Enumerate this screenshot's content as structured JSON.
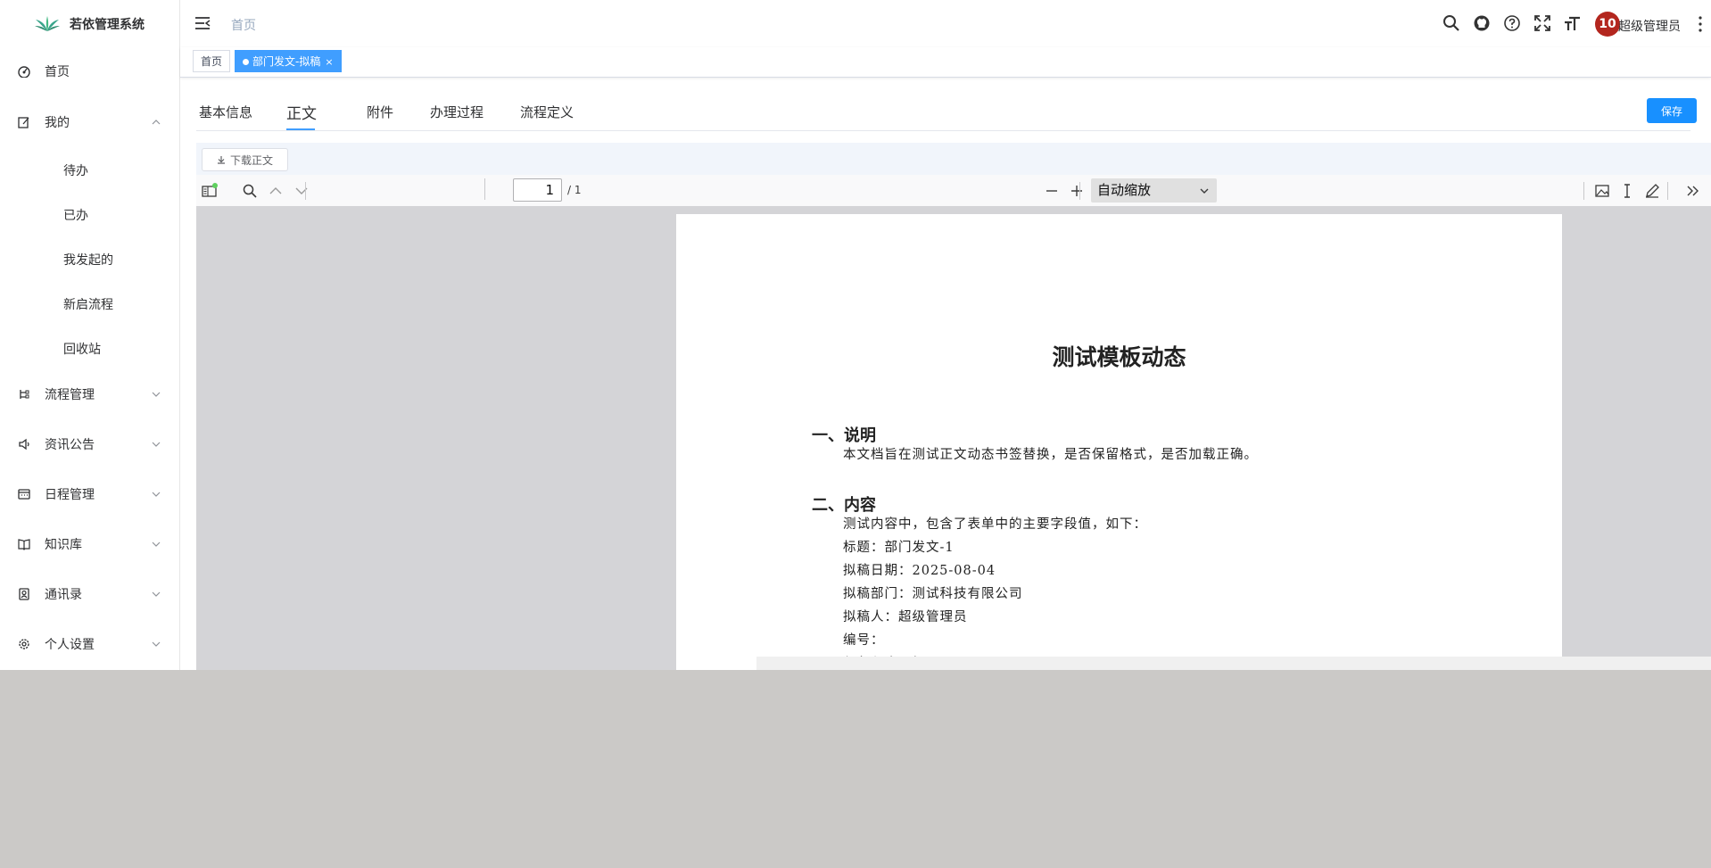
{
  "app": {
    "title": "若依管理系统"
  },
  "sidebar": {
    "items": [
      {
        "label": "首页",
        "icon": "dashboard-icon"
      },
      {
        "label": "我的",
        "icon": "edit-icon",
        "expanded": true,
        "children": [
          "待办",
          "已办",
          "我发起的",
          "新启流程",
          "回收站"
        ]
      },
      {
        "label": "流程管理",
        "icon": "tree-icon"
      },
      {
        "label": "资讯公告",
        "icon": "speaker-icon"
      },
      {
        "label": "日程管理",
        "icon": "calendar-icon"
      },
      {
        "label": "知识库",
        "icon": "book-icon"
      },
      {
        "label": "通讯录",
        "icon": "contacts-icon"
      },
      {
        "label": "个人设置",
        "icon": "settings-icon"
      }
    ]
  },
  "navbar": {
    "breadcrumb": "首页",
    "avatar_text": "10",
    "user_name": "超级管理员"
  },
  "tags": [
    {
      "label": "首页",
      "active": false
    },
    {
      "label": "部门发文-拟稿",
      "active": true,
      "close": "×"
    }
  ],
  "tabs": [
    "基本信息",
    "正文",
    "附件",
    "办理过程",
    "流程定义"
  ],
  "active_tab": "正文",
  "save_label": "保存",
  "download_label": "下载正文",
  "pdf": {
    "page_value": "1",
    "page_total": "/ 1",
    "zoom_label": "自动缩放"
  },
  "document": {
    "title": "测试模板动态",
    "section1_heading": "一、说明",
    "section1_text": "本文档旨在测试正文动态书签替换，是否保留格式，是否加载正确。",
    "section2_heading": "二、内容",
    "lines": [
      "测试内容中，包含了表单中的主要字段值，如下：",
      "标题：部门发文-1",
      "拟稿日期：2025-08-04",
      "拟稿部门：测试科技有限公司",
      "拟稿人：超级管理员",
      "编号：",
      "紧急程度：加"
    ]
  },
  "colors": {
    "primary": "#409eff",
    "save": "#1890ff",
    "avatar": "#b3261e"
  }
}
